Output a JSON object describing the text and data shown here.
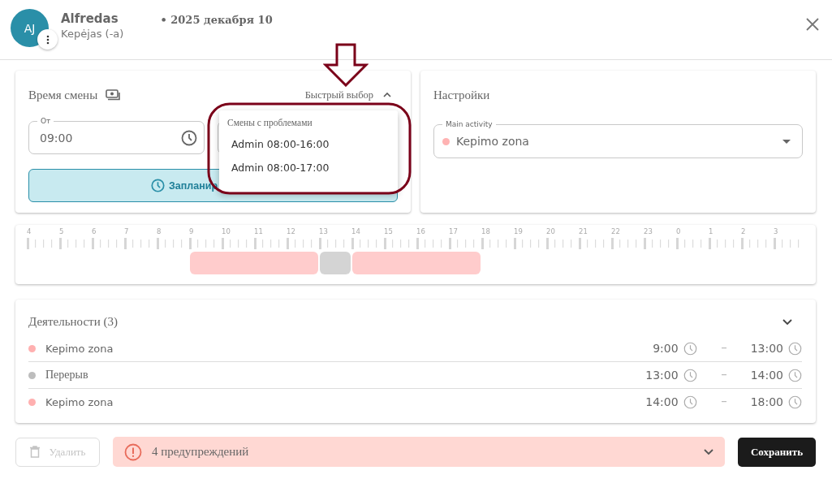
{
  "header": {
    "avatar_initials": "AJ",
    "name": "Alfredas",
    "role": "Kepėjas (-a)",
    "date": "• 2025 декабря 10"
  },
  "shift_time": {
    "title": "Время смены",
    "quick_select": {
      "label": "Быстрый выбор",
      "expanded": true
    },
    "from": {
      "label": "От",
      "value": "09:00"
    },
    "plan_button": "Запланир",
    "dropdown": {
      "section": "Смены с проблемами",
      "items": [
        "Admin 08:00-16:00",
        "Admin 08:00-17:00"
      ]
    }
  },
  "settings": {
    "title": "Настройки",
    "main_activity": {
      "label": "Main activity",
      "value": "Kepimo zona",
      "color": "#ffb3b3"
    }
  },
  "timeline": {
    "hours": [
      "4",
      "5",
      "6",
      "7",
      "8",
      "9",
      "10",
      "11",
      "12",
      "13",
      "14",
      "15",
      "16",
      "17",
      "18",
      "19",
      "20",
      "21",
      "22",
      "23",
      "0",
      "1",
      "2",
      "3"
    ]
  },
  "activities": {
    "title": "Деятельности (3)",
    "expanded": true,
    "rows": [
      {
        "name": "Kepimo zona",
        "kind": "activity",
        "color": "#ffb0b0",
        "start": "9:00",
        "end": "13:00"
      },
      {
        "name": "Перерыв",
        "kind": "break",
        "color": "#bdbdbd",
        "start": "13:00",
        "end": "14:00"
      },
      {
        "name": "Kepimo zona",
        "kind": "activity",
        "color": "#ffb0b0",
        "start": "14:00",
        "end": "18:00"
      }
    ]
  },
  "footer": {
    "delete": {
      "label": "Удалить",
      "disabled": true
    },
    "warnings": {
      "text": "4 предупреждений",
      "expanded": false
    },
    "save": "Сохранить"
  }
}
